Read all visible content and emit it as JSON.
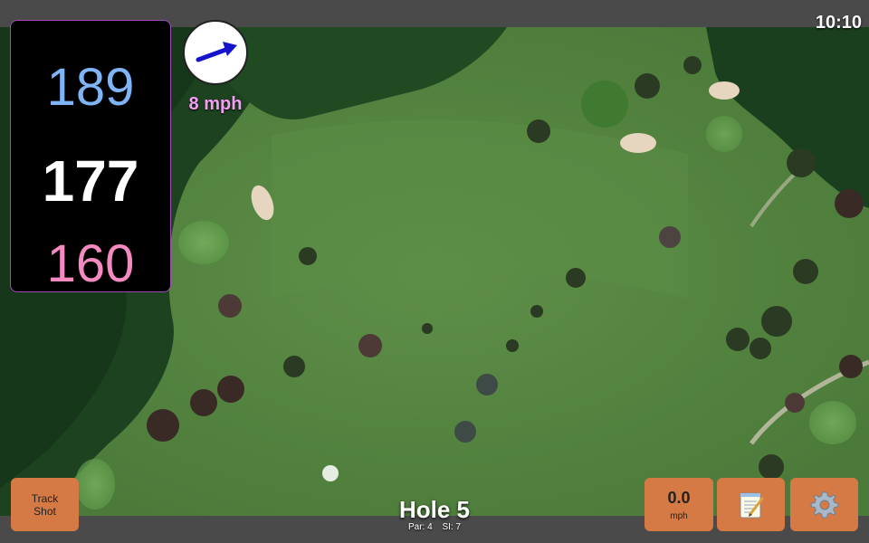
{
  "status": {
    "time": "10:10"
  },
  "yardage": {
    "back": "189",
    "center": "177",
    "front": "160"
  },
  "wind": {
    "speed": "8 mph",
    "direction_icon": "wind-arrow-icon"
  },
  "buttons": {
    "track_shot_line1": "Track",
    "track_shot_line2": "Shot",
    "speed_value": "0.0",
    "speed_unit": "mph",
    "notes_icon": "notepad-icon",
    "settings_icon": "gear-icon"
  },
  "hole": {
    "title": "Hole 5",
    "par": "Par: 4",
    "si": "SI: 7"
  },
  "colors": {
    "accent_button": "#d57a45",
    "back_yardage": "#7fb4f7",
    "front_yardage": "#f48ac0",
    "wind_text": "#f39df5"
  }
}
